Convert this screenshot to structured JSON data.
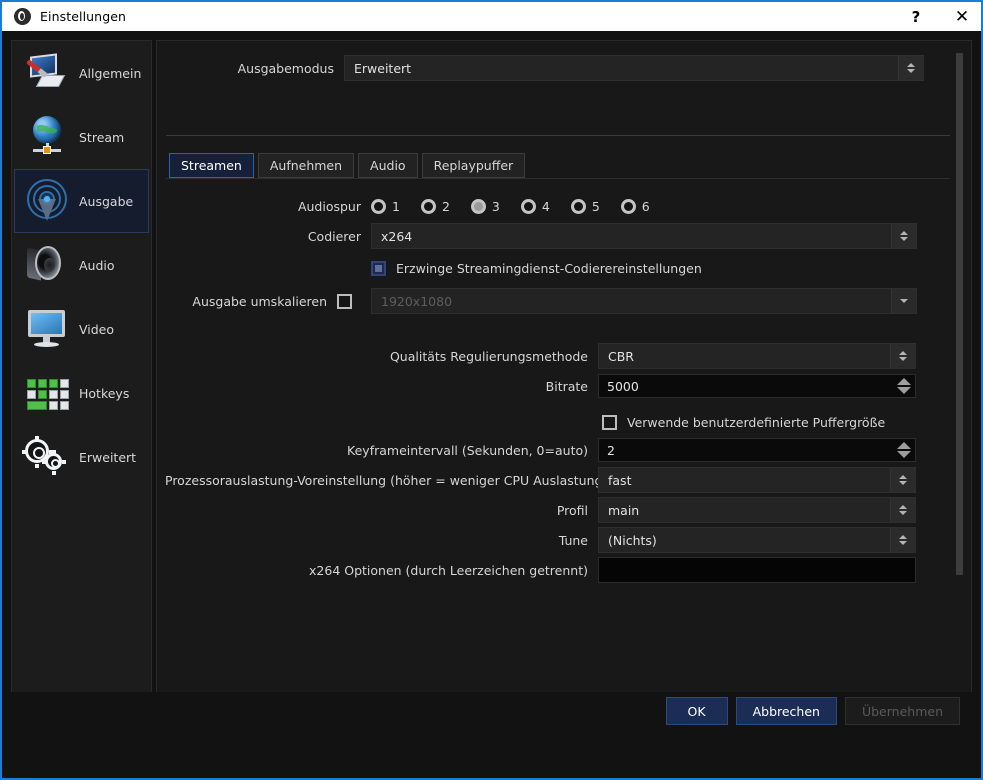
{
  "window": {
    "title": "Einstellungen",
    "logo_icon": "obs-logo-icon",
    "help_label": "?",
    "close_label": "✕",
    "accent": "#1a7fd4"
  },
  "sidebar": {
    "items": [
      {
        "label": "Allgemein",
        "icon": "general-icon",
        "active": false
      },
      {
        "label": "Stream",
        "icon": "stream-icon",
        "active": false
      },
      {
        "label": "Ausgabe",
        "icon": "output-icon",
        "active": true
      },
      {
        "label": "Audio",
        "icon": "audio-icon",
        "active": false
      },
      {
        "label": "Video",
        "icon": "video-icon",
        "active": false
      },
      {
        "label": "Hotkeys",
        "icon": "hotkeys-icon",
        "active": false
      },
      {
        "label": "Erweitert",
        "icon": "advanced-icon",
        "active": false
      }
    ]
  },
  "output_mode": {
    "label": "Ausgabemodus",
    "value": "Erweitert"
  },
  "tabs": [
    {
      "label": "Streamen",
      "active": true
    },
    {
      "label": "Aufnehmen",
      "active": false
    },
    {
      "label": "Audio",
      "active": false
    },
    {
      "label": "Replaypuffer",
      "active": false
    }
  ],
  "form": {
    "audio_track": {
      "label": "Audiospur",
      "options": [
        "1",
        "2",
        "3",
        "4",
        "5",
        "6"
      ],
      "selected": "3"
    },
    "encoder": {
      "label": "Codierer",
      "value": "x264"
    },
    "enforce_service_settings": {
      "label": "Erzwinge Streamingdienst-Codierereinstellungen",
      "checked": true
    },
    "rescale_output": {
      "label": "Ausgabe umskalieren",
      "checked": false,
      "value": "1920x1080",
      "disabled": true
    },
    "rate_control": {
      "label": "Qualitäts Regulierungsmethode",
      "value": "CBR"
    },
    "bitrate": {
      "label": "Bitrate",
      "value": "5000"
    },
    "custom_buffer": {
      "label": "Verwende benutzerdefinierte Puffergröße",
      "checked": false
    },
    "keyframe_interval": {
      "label": "Keyframeintervall (Sekunden, 0=auto)",
      "value": "2"
    },
    "cpu_preset": {
      "label": "Prozessorauslastung-Voreinstellung (höher = weniger CPU Auslastung)",
      "value": "fast"
    },
    "profile": {
      "label": "Profil",
      "value": "main"
    },
    "tune": {
      "label": "Tune",
      "value": "(Nichts)"
    },
    "x264_options": {
      "label": "x264 Optionen (durch Leerzeichen getrennt)",
      "value": ""
    }
  },
  "footer": {
    "ok": "OK",
    "cancel": "Abbrechen",
    "apply": "Übernehmen",
    "apply_disabled": true
  }
}
